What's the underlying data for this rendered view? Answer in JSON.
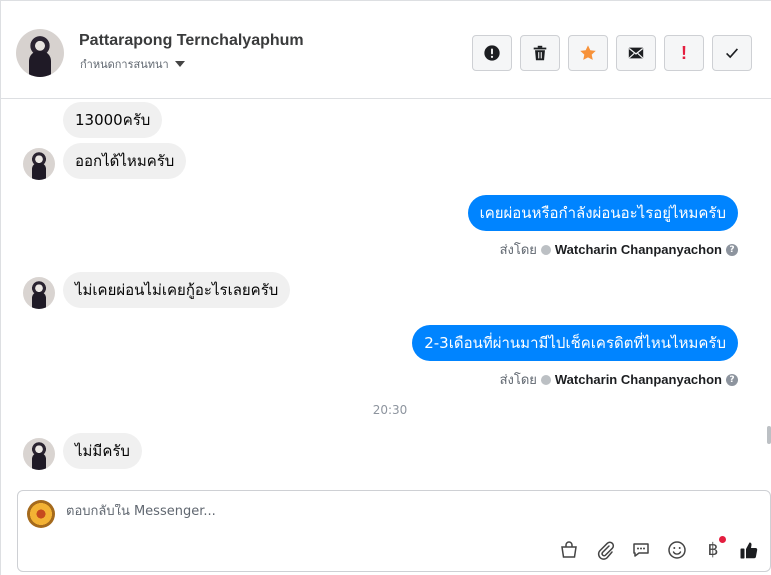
{
  "header": {
    "contact_name": "Pattarapong Ternchalyaphum",
    "subtitle": "กำหนดการสนทนา",
    "actions": [
      {
        "name": "spam",
        "icon": "exclamation-circle-icon"
      },
      {
        "name": "delete",
        "icon": "trash-icon"
      },
      {
        "name": "star",
        "icon": "star-icon"
      },
      {
        "name": "mark-unread",
        "icon": "envelope-icon"
      },
      {
        "name": "follow-up",
        "icon": "exclamation-icon",
        "label": "!"
      },
      {
        "name": "done",
        "icon": "checkmark-icon"
      }
    ]
  },
  "messages": [
    {
      "id": "m1",
      "direction": "in",
      "text": "13000ครับ",
      "show_avatar": false
    },
    {
      "id": "m2",
      "direction": "in",
      "text": "ออกได้ไหมครับ",
      "show_avatar": true
    },
    {
      "id": "m3",
      "direction": "out",
      "text": "เคยผ่อนหรือกำลังผ่อนอะไรอยู่ไหมครับ",
      "sent_by_label": "ส่งโดย",
      "sent_by_name": "Watcharin Chanpanyachon"
    },
    {
      "id": "m4",
      "direction": "in",
      "text": "ไม่เคยผ่อนไม่เคยกู้อะไรเลยครับ",
      "show_avatar": true
    },
    {
      "id": "m5",
      "direction": "out",
      "text": "2-3เดือนที่ผ่านมามีไปเช็คเครดิตที่ไหนไหมครับ",
      "sent_by_label": "ส่งโดย",
      "sent_by_name": "Watcharin Chanpanyachon"
    },
    {
      "id": "m6",
      "direction": "in",
      "text": "ไม่มีครับ",
      "show_avatar": true
    }
  ],
  "timestamp": "20:30",
  "composer": {
    "placeholder": "ตอบกลับใน Messenger...",
    "tools": [
      "shopping-bag-icon",
      "paperclip-icon",
      "chat-bubble-icon",
      "smiley-icon",
      "baht-icon",
      "thumbs-up-icon"
    ],
    "baht_symbol": "฿"
  },
  "colors": {
    "outgoing_bubble": "#0084ff",
    "incoming_bubble": "#f0f0f0",
    "star": "#f7923a",
    "alert": "#e41e3f"
  }
}
